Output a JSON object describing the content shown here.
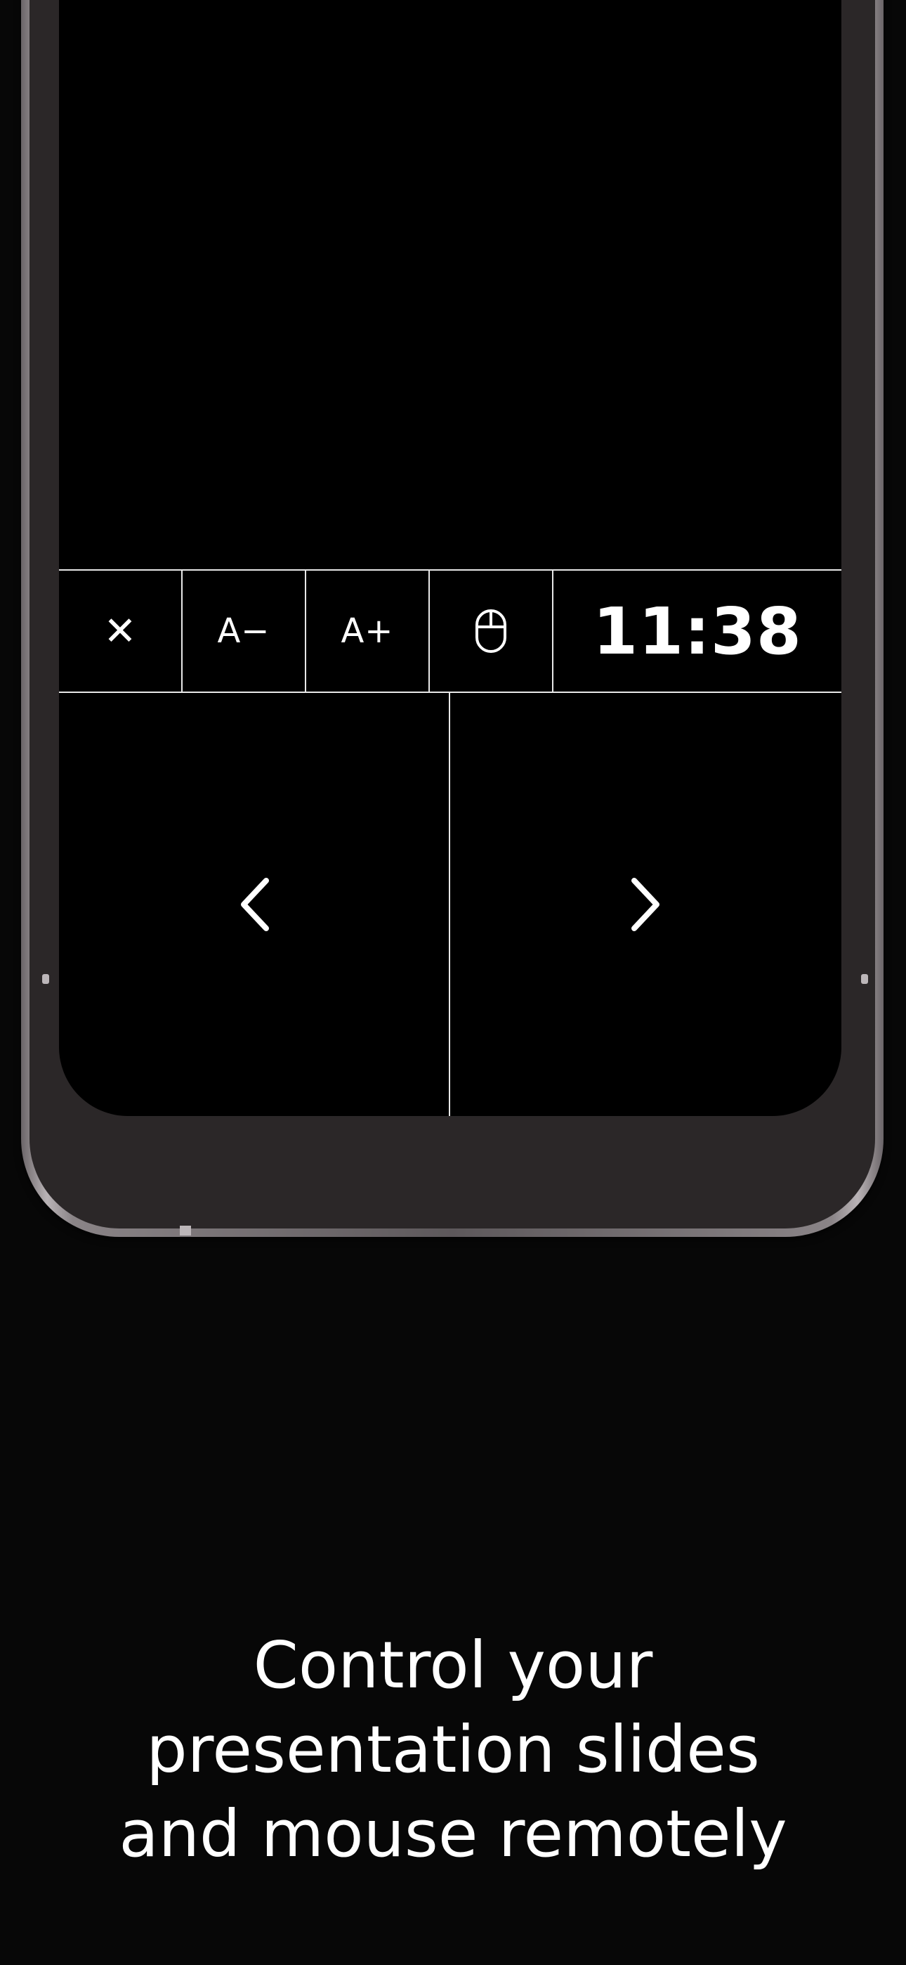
{
  "toolbar": {
    "close_glyph": "✕",
    "font_decrease_label": "A−",
    "font_increase_label": "A+",
    "clock": "11:38"
  },
  "icons": {
    "close": "close-icon",
    "mouse": "mouse-icon",
    "previous": "chevron-left-icon",
    "next": "chevron-right-icon"
  },
  "caption": {
    "line1": "Control your",
    "line2": "presentation slides",
    "line3": "and mouse remotely"
  },
  "colors": {
    "background": "#070707",
    "screen": "#000000",
    "lines": "#e8e8e8",
    "text": "#ffffff"
  }
}
